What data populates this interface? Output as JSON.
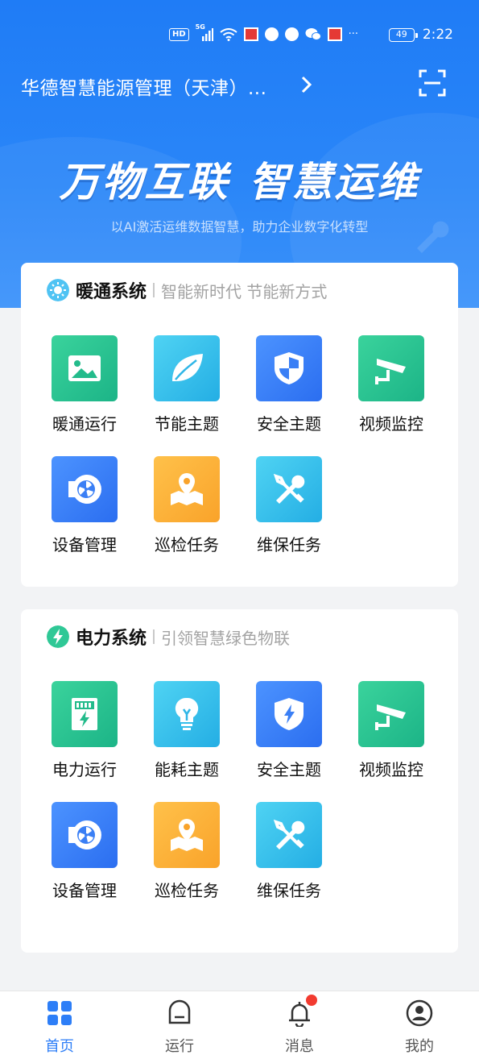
{
  "status_bar": {
    "hd": "HD",
    "net": "5G",
    "more": "···",
    "battery": "49",
    "time": "2:22"
  },
  "header": {
    "org_name": "华德智慧能源管理（天津）..."
  },
  "banner": {
    "slogan_left": "万物互联",
    "slogan_right": "智慧运维",
    "subtitle": "以AI激活运维数据智慧，助力企业数字化转型"
  },
  "hvac": {
    "title": "暖通系统",
    "subtitle": "智能新时代 节能新方式",
    "items": [
      {
        "label": "暖通运行",
        "icon": "picture-icon"
      },
      {
        "label": "节能主题",
        "icon": "leaf-icon"
      },
      {
        "label": "安全主题",
        "icon": "shield-icon"
      },
      {
        "label": "视频监控",
        "icon": "cctv-camera-icon"
      },
      {
        "label": "设备管理",
        "icon": "fan-device-icon"
      },
      {
        "label": "巡检任务",
        "icon": "map-pin-icon"
      },
      {
        "label": "维保任务",
        "icon": "tools-icon"
      }
    ]
  },
  "power": {
    "title": "电力系统",
    "subtitle": "引领智慧绿色物联",
    "items": [
      {
        "label": "电力运行",
        "icon": "power-meter-icon"
      },
      {
        "label": "能耗主题",
        "icon": "lightbulb-icon"
      },
      {
        "label": "安全主题",
        "icon": "shield-bolt-icon"
      },
      {
        "label": "视频监控",
        "icon": "cctv-camera-icon"
      },
      {
        "label": "设备管理",
        "icon": "fan-device-icon"
      },
      {
        "label": "巡检任务",
        "icon": "map-pin-icon"
      },
      {
        "label": "维保任务",
        "icon": "tools-icon"
      }
    ]
  },
  "tabbar": {
    "tabs": [
      {
        "label": "首页",
        "icon": "grid-home-icon",
        "active": true
      },
      {
        "label": "运行",
        "icon": "run-box-icon",
        "active": false
      },
      {
        "label": "消息",
        "icon": "bell-icon",
        "active": false
      },
      {
        "label": "我的",
        "icon": "profile-icon",
        "active": false
      }
    ]
  },
  "colors": {
    "brand_blue": "#2a86f8",
    "active_tab": "#2d7ef7",
    "badge_red": "#f23b30"
  }
}
